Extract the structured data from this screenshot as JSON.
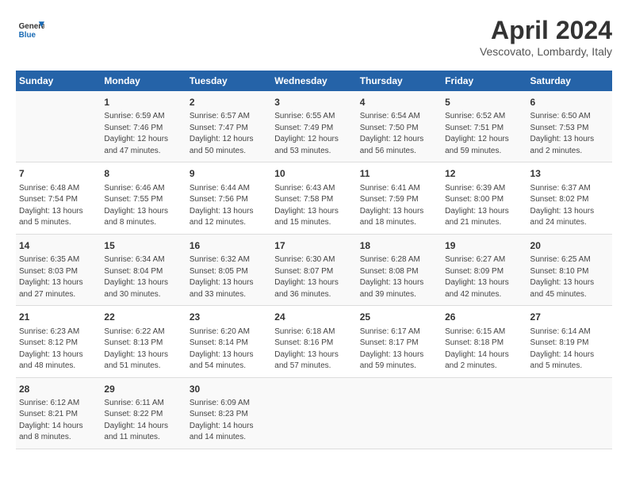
{
  "header": {
    "logo_line1": "General",
    "logo_line2": "Blue",
    "month": "April 2024",
    "location": "Vescovato, Lombardy, Italy"
  },
  "days_of_week": [
    "Sunday",
    "Monday",
    "Tuesday",
    "Wednesday",
    "Thursday",
    "Friday",
    "Saturday"
  ],
  "weeks": [
    [
      {
        "day": "",
        "info": ""
      },
      {
        "day": "1",
        "info": "Sunrise: 6:59 AM\nSunset: 7:46 PM\nDaylight: 12 hours\nand 47 minutes."
      },
      {
        "day": "2",
        "info": "Sunrise: 6:57 AM\nSunset: 7:47 PM\nDaylight: 12 hours\nand 50 minutes."
      },
      {
        "day": "3",
        "info": "Sunrise: 6:55 AM\nSunset: 7:49 PM\nDaylight: 12 hours\nand 53 minutes."
      },
      {
        "day": "4",
        "info": "Sunrise: 6:54 AM\nSunset: 7:50 PM\nDaylight: 12 hours\nand 56 minutes."
      },
      {
        "day": "5",
        "info": "Sunrise: 6:52 AM\nSunset: 7:51 PM\nDaylight: 12 hours\nand 59 minutes."
      },
      {
        "day": "6",
        "info": "Sunrise: 6:50 AM\nSunset: 7:53 PM\nDaylight: 13 hours\nand 2 minutes."
      }
    ],
    [
      {
        "day": "7",
        "info": "Sunrise: 6:48 AM\nSunset: 7:54 PM\nDaylight: 13 hours\nand 5 minutes."
      },
      {
        "day": "8",
        "info": "Sunrise: 6:46 AM\nSunset: 7:55 PM\nDaylight: 13 hours\nand 8 minutes."
      },
      {
        "day": "9",
        "info": "Sunrise: 6:44 AM\nSunset: 7:56 PM\nDaylight: 13 hours\nand 12 minutes."
      },
      {
        "day": "10",
        "info": "Sunrise: 6:43 AM\nSunset: 7:58 PM\nDaylight: 13 hours\nand 15 minutes."
      },
      {
        "day": "11",
        "info": "Sunrise: 6:41 AM\nSunset: 7:59 PM\nDaylight: 13 hours\nand 18 minutes."
      },
      {
        "day": "12",
        "info": "Sunrise: 6:39 AM\nSunset: 8:00 PM\nDaylight: 13 hours\nand 21 minutes."
      },
      {
        "day": "13",
        "info": "Sunrise: 6:37 AM\nSunset: 8:02 PM\nDaylight: 13 hours\nand 24 minutes."
      }
    ],
    [
      {
        "day": "14",
        "info": "Sunrise: 6:35 AM\nSunset: 8:03 PM\nDaylight: 13 hours\nand 27 minutes."
      },
      {
        "day": "15",
        "info": "Sunrise: 6:34 AM\nSunset: 8:04 PM\nDaylight: 13 hours\nand 30 minutes."
      },
      {
        "day": "16",
        "info": "Sunrise: 6:32 AM\nSunset: 8:05 PM\nDaylight: 13 hours\nand 33 minutes."
      },
      {
        "day": "17",
        "info": "Sunrise: 6:30 AM\nSunset: 8:07 PM\nDaylight: 13 hours\nand 36 minutes."
      },
      {
        "day": "18",
        "info": "Sunrise: 6:28 AM\nSunset: 8:08 PM\nDaylight: 13 hours\nand 39 minutes."
      },
      {
        "day": "19",
        "info": "Sunrise: 6:27 AM\nSunset: 8:09 PM\nDaylight: 13 hours\nand 42 minutes."
      },
      {
        "day": "20",
        "info": "Sunrise: 6:25 AM\nSunset: 8:10 PM\nDaylight: 13 hours\nand 45 minutes."
      }
    ],
    [
      {
        "day": "21",
        "info": "Sunrise: 6:23 AM\nSunset: 8:12 PM\nDaylight: 13 hours\nand 48 minutes."
      },
      {
        "day": "22",
        "info": "Sunrise: 6:22 AM\nSunset: 8:13 PM\nDaylight: 13 hours\nand 51 minutes."
      },
      {
        "day": "23",
        "info": "Sunrise: 6:20 AM\nSunset: 8:14 PM\nDaylight: 13 hours\nand 54 minutes."
      },
      {
        "day": "24",
        "info": "Sunrise: 6:18 AM\nSunset: 8:16 PM\nDaylight: 13 hours\nand 57 minutes."
      },
      {
        "day": "25",
        "info": "Sunrise: 6:17 AM\nSunset: 8:17 PM\nDaylight: 13 hours\nand 59 minutes."
      },
      {
        "day": "26",
        "info": "Sunrise: 6:15 AM\nSunset: 8:18 PM\nDaylight: 14 hours\nand 2 minutes."
      },
      {
        "day": "27",
        "info": "Sunrise: 6:14 AM\nSunset: 8:19 PM\nDaylight: 14 hours\nand 5 minutes."
      }
    ],
    [
      {
        "day": "28",
        "info": "Sunrise: 6:12 AM\nSunset: 8:21 PM\nDaylight: 14 hours\nand 8 minutes."
      },
      {
        "day": "29",
        "info": "Sunrise: 6:11 AM\nSunset: 8:22 PM\nDaylight: 14 hours\nand 11 minutes."
      },
      {
        "day": "30",
        "info": "Sunrise: 6:09 AM\nSunset: 8:23 PM\nDaylight: 14 hours\nand 14 minutes."
      },
      {
        "day": "",
        "info": ""
      },
      {
        "day": "",
        "info": ""
      },
      {
        "day": "",
        "info": ""
      },
      {
        "day": "",
        "info": ""
      }
    ]
  ]
}
